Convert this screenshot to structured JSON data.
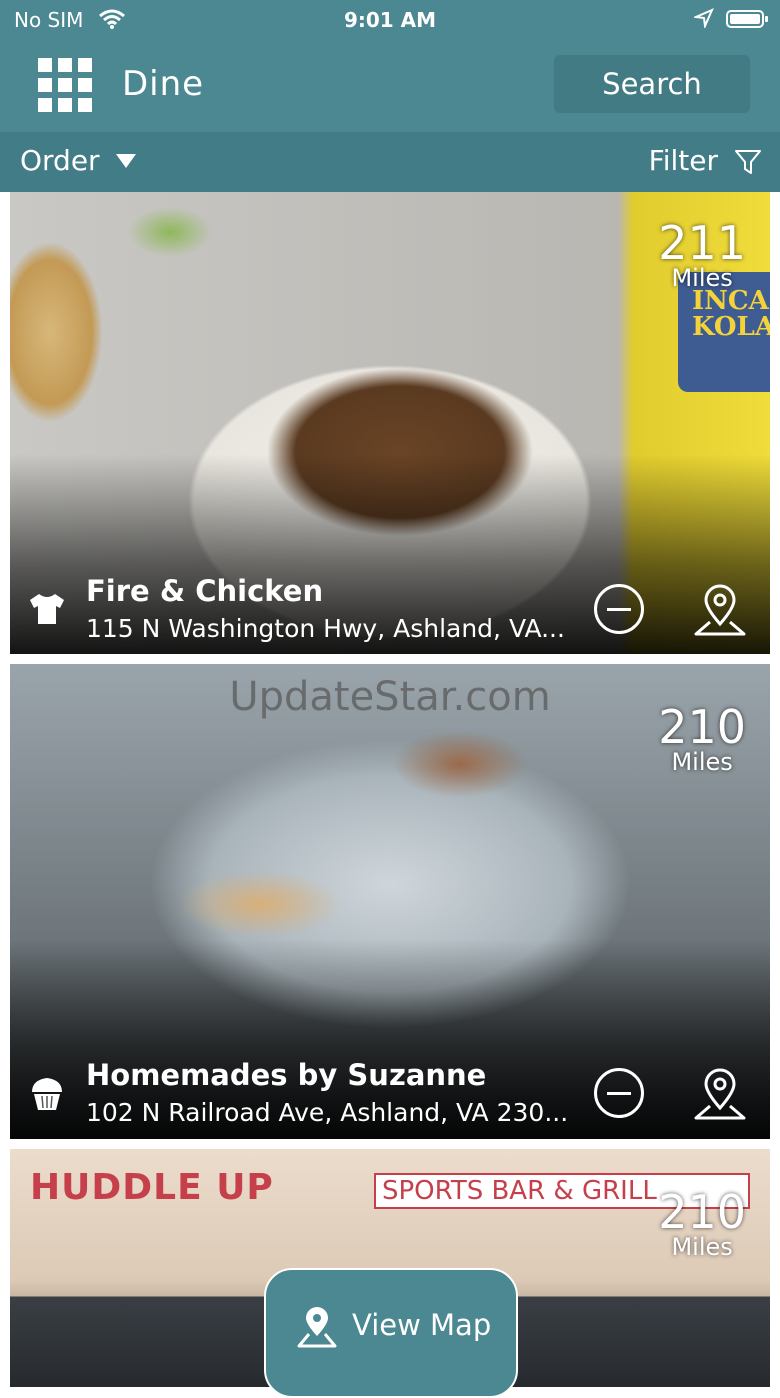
{
  "status_bar": {
    "carrier": "No SIM",
    "time": "9:01 AM"
  },
  "header": {
    "title": "Dine",
    "search_label": "Search"
  },
  "toolbar": {
    "order_label": "Order",
    "filter_label": "Filter"
  },
  "listings": [
    {
      "name": "Fire & Chicken",
      "address": "115 N Washington Hwy, Ashland, VA...",
      "distance": "211",
      "unit": "Miles",
      "category_icon": "shirt-icon"
    },
    {
      "name": "Homemades by Suzanne",
      "address": "102 N Railroad Ave, Ashland, VA 230...",
      "distance": "210",
      "unit": "Miles",
      "category_icon": "cupcake-icon",
      "watermark": "UpdateStar.com"
    },
    {
      "distance": "210",
      "unit": "Miles",
      "sign_left": "HUDDLE UP",
      "sign_right": "SPORTS BAR & GRILL"
    }
  ],
  "photo_text": {
    "bottle": "INCA KOLA"
  },
  "footer": {
    "view_map_label": "View Map"
  },
  "colors": {
    "primary": "#4b8892",
    "secondary": "#427c86",
    "sign_red": "#c6404c"
  }
}
